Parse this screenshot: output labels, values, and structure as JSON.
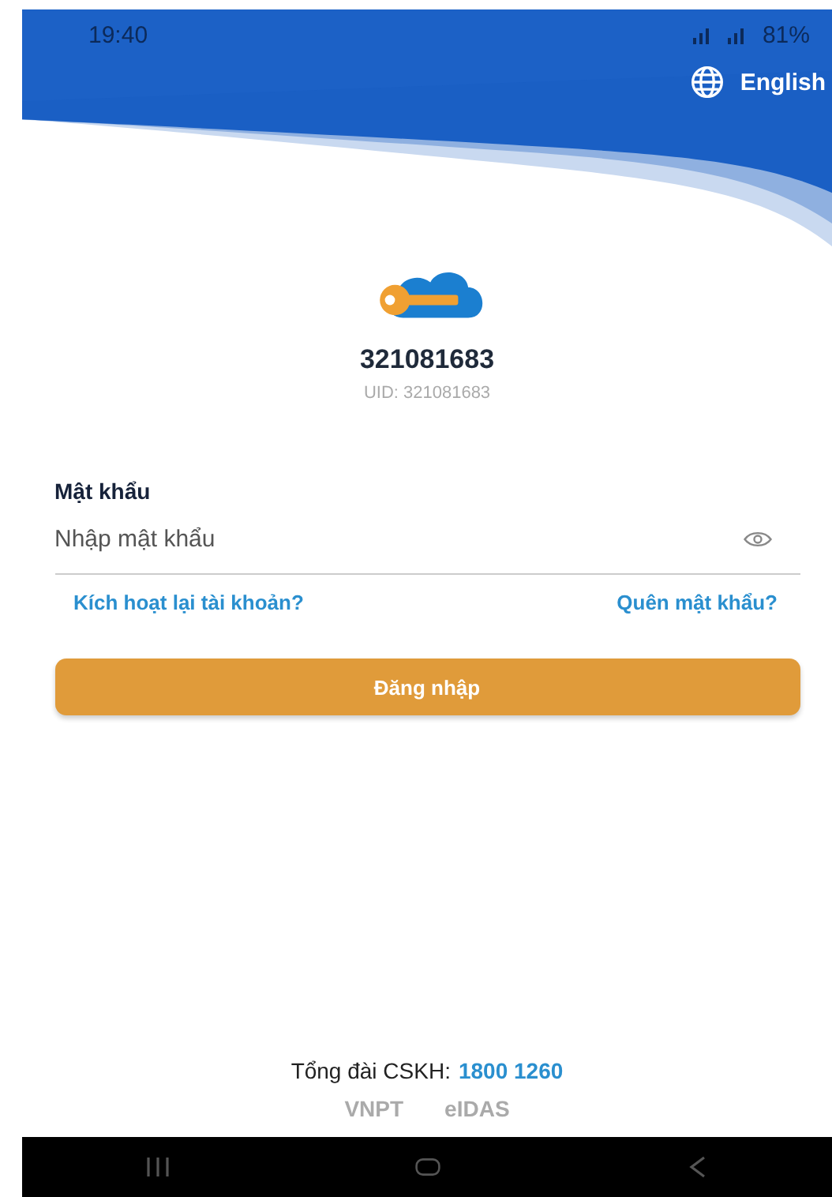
{
  "status_bar": {
    "time": "19:40",
    "battery": "81%"
  },
  "language": {
    "label": "English"
  },
  "account": {
    "name": "321081683",
    "uid": "UID: 321081683"
  },
  "password": {
    "label": "Mật khẩu",
    "placeholder": "Nhập mật khẩu"
  },
  "links": [
    "Kích hoạt lại tài khoản?",
    "Quên mật khẩu?"
  ],
  "login_button": "Đăng nhập",
  "footer": {
    "hotline_label": "Tổng đài CSKH:",
    "hotline_number": "1800 1260",
    "logos": [
      "VNPT",
      "eIDAS"
    ]
  }
}
